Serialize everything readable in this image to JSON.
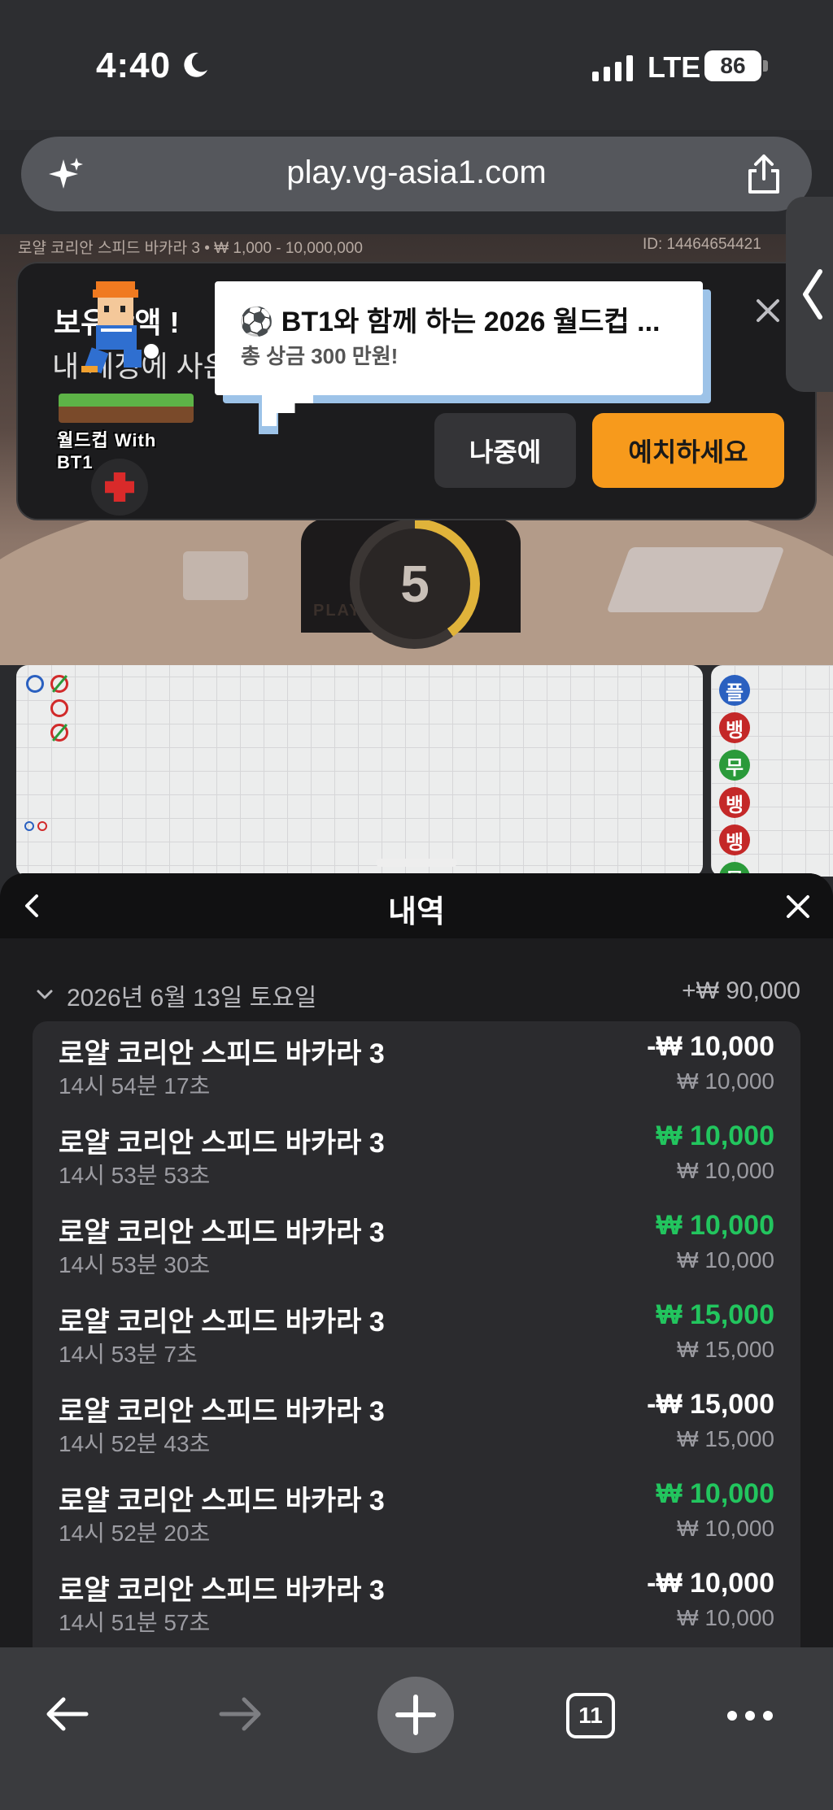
{
  "status_bar": {
    "time": "4:40",
    "network": "LTE",
    "battery": "86",
    "moon_icon": "moon-icon"
  },
  "browser": {
    "url": "play.vg-asia1.com",
    "tabs_count": "11"
  },
  "game": {
    "table_info": "로얄 코리안 스피드 바카라 3 • ₩ 1,000 - 10,000,000",
    "game_id": "ID: 14464654421",
    "countdown": "5",
    "felt_label": "PLAYER  BANKER"
  },
  "popup": {
    "bg_text_1": "보유잔액 !",
    "bg_text_2": "내 계정에 사은",
    "badge_text": "월드컵 With BT1",
    "title": "⚽ BT1와 함께 하는 2026 월드컵 ...",
    "subtitle": "총 상금 300 만원!",
    "later_label": "나중에",
    "deposit_label": "예치하세요"
  },
  "road_side": {
    "pills": [
      {
        "label": "플",
        "type": "b"
      },
      {
        "label": "뱅",
        "type": "r"
      },
      {
        "label": "무",
        "type": "g"
      },
      {
        "label": "뱅",
        "type": "r"
      },
      {
        "label": "뱅",
        "type": "r"
      },
      {
        "label": "무",
        "type": "g"
      }
    ]
  },
  "history": {
    "title": "내역",
    "date": "2026년 6월 13일 토요일",
    "total": "+₩ 90,000",
    "rows": [
      {
        "name": "로얄 코리안 스피드 바카라 3",
        "time": "14시 54분 17초",
        "amount": "-₩ 10,000",
        "stake": "₩ 10,000",
        "sign": "neg"
      },
      {
        "name": "로얄 코리안 스피드 바카라 3",
        "time": "14시 53분 53초",
        "amount": "₩ 10,000",
        "stake": "₩ 10,000",
        "sign": "pos"
      },
      {
        "name": "로얄 코리안 스피드 바카라 3",
        "time": "14시 53분 30초",
        "amount": "₩ 10,000",
        "stake": "₩ 10,000",
        "sign": "pos"
      },
      {
        "name": "로얄 코리안 스피드 바카라 3",
        "time": "14시 53분 7초",
        "amount": "₩ 15,000",
        "stake": "₩ 15,000",
        "sign": "pos"
      },
      {
        "name": "로얄 코리안 스피드 바카라 3",
        "time": "14시 52분 43초",
        "amount": "-₩ 15,000",
        "stake": "₩ 15,000",
        "sign": "neg"
      },
      {
        "name": "로얄 코리안 스피드 바카라 3",
        "time": "14시 52분 20초",
        "amount": "₩ 10,000",
        "stake": "₩ 10,000",
        "sign": "pos"
      },
      {
        "name": "로얄 코리안 스피드 바카라 3",
        "time": "14시 51분 57초",
        "amount": "-₩ 10,000",
        "stake": "₩ 10,000",
        "sign": "neg"
      }
    ]
  },
  "colors": {
    "accent_orange": "#f79a1c",
    "win_green": "#22c55e",
    "banker_red": "#c42828",
    "player_blue": "#2a60c0"
  }
}
